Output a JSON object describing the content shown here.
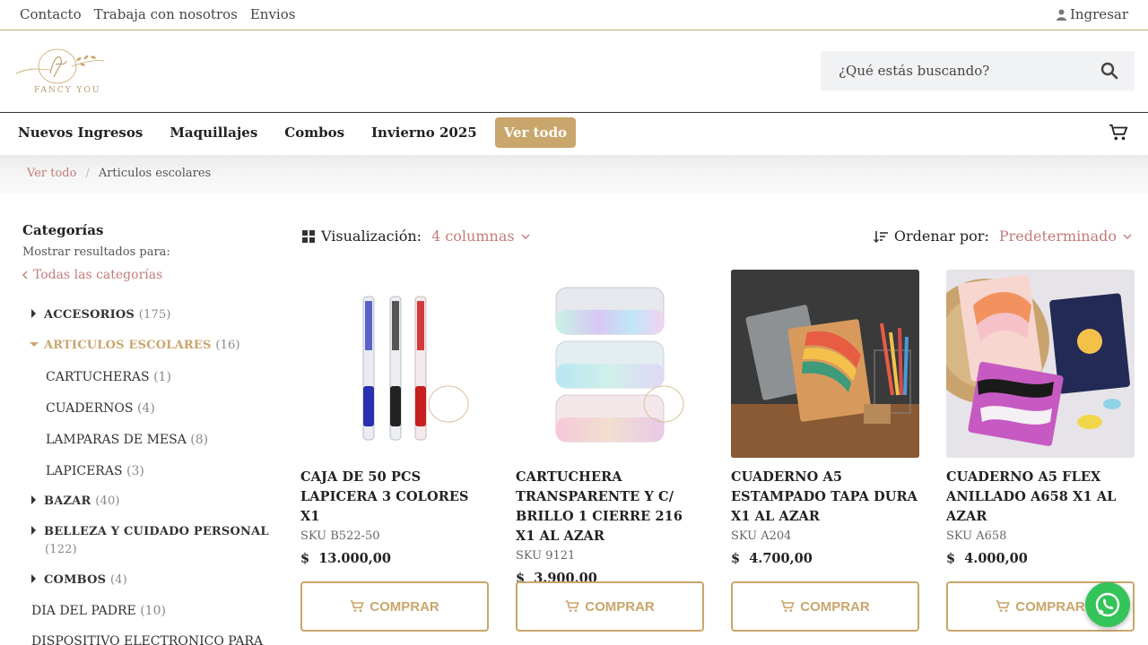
{
  "topbar": {
    "links": [
      "Contacto",
      "Trabaja con nosotros",
      "Envios"
    ],
    "login": "Ingresar"
  },
  "header": {
    "logo_text": "FANCY YOU",
    "search_placeholder": "¿Qué estás buscando?"
  },
  "nav": {
    "items": [
      "Nuevos Ingresos",
      "Maquillajes",
      "Combos",
      "Invierno 2025",
      "Ver todo"
    ],
    "active": "Ver todo"
  },
  "breadcrumb": {
    "root": "Ver todo",
    "separator": "/",
    "current": "Articulos escolares"
  },
  "sidebar": {
    "title": "Categorías",
    "show_results": "Mostrar resultados para:",
    "all_categories": "Todas las categorías",
    "categories": [
      {
        "label": "ACCESORIOS",
        "count": "(175)"
      },
      {
        "label": "ARTICULOS ESCOLARES",
        "count": "(16)"
      },
      {
        "label": "CARTUCHERAS",
        "count": "(1)"
      },
      {
        "label": "CUADERNOS",
        "count": "(4)"
      },
      {
        "label": "LAMPARAS DE MESA",
        "count": "(8)"
      },
      {
        "label": "LAPICERAS",
        "count": "(3)"
      },
      {
        "label": "BAZAR",
        "count": "(40)"
      },
      {
        "label": "BELLEZA Y CUIDADO PERSONAL",
        "count": "(122)"
      },
      {
        "label": "COMBOS",
        "count": "(4)"
      },
      {
        "label": "DIA DEL PADRE",
        "count": "(10)"
      },
      {
        "label": "DISPOSITIVO ELECTRONICO PARA",
        "count": ""
      }
    ]
  },
  "toolbar": {
    "view_label": "Visualización:",
    "view_value": "4 columnas",
    "sort_label": "Ordenar por:",
    "sort_value": "Predeterminado"
  },
  "products": [
    {
      "name": "CAJA DE 50 PCS LAPICERA 3 COLORES X1",
      "sku": "SKU B522-50",
      "currency": "$",
      "price": "13.000,00"
    },
    {
      "name": "CARTUCHERA TRANSPARENTE Y C/ BRILLO 1 CIERRE 216 X1 AL AZAR",
      "sku": "SKU 9121",
      "currency": "$",
      "price": "3.900,00"
    },
    {
      "name": "CUADERNO A5 ESTAMPADO TAPA DURA X1 AL AZAR",
      "sku": "SKU A204",
      "currency": "$",
      "price": "4.700,00"
    },
    {
      "name": "CUADERNO A5 FLEX ANILLADO A658 X1 AL AZAR",
      "sku": "SKU A658",
      "currency": "$",
      "price": "4.000,00"
    }
  ],
  "buy_label": "COMPRAR",
  "colors": {
    "accent": "#c9a66b",
    "link": "#c57b7b",
    "whatsapp": "#34c45a"
  }
}
